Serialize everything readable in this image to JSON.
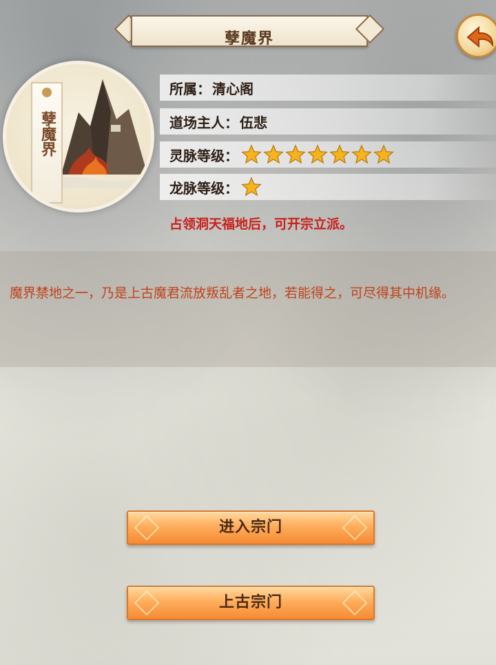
{
  "header": {
    "title": "孽魔界",
    "back_icon": "back-arrow-icon"
  },
  "portrait": {
    "banner_text": "孽魔界",
    "image": "demon-mountain-illustration"
  },
  "info": {
    "affiliation_label": "所属：",
    "affiliation_value": "清心阁",
    "owner_label": "道场主人：",
    "owner_value": "伍悲",
    "spirit_vein_label": "灵脉等级：",
    "spirit_vein_stars": 7,
    "dragon_vein_label": "龙脉等级：",
    "dragon_vein_stars": 1,
    "notice": "占领洞天福地后，可开宗立派。"
  },
  "description": "魔界禁地之一，乃是上古魔君流放叛乱者之地，若能得之，可尽得其中机缘。",
  "buttons": {
    "enter_sect": "进入宗门",
    "ancient_sect": "上古宗门"
  },
  "colors": {
    "notice": "#c8201c",
    "description": "#c0421a",
    "button": "#ffae5c",
    "star": "#f5b31e"
  }
}
